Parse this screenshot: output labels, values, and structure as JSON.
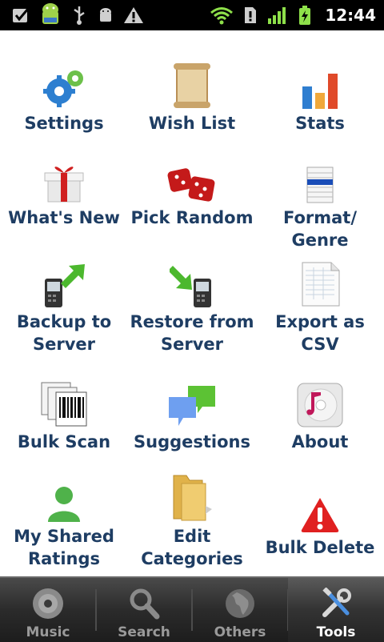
{
  "status": {
    "time": "12:44"
  },
  "tiles": [
    {
      "label": "Settings",
      "icon": "gears-icon"
    },
    {
      "label": "Wish List",
      "icon": "scroll-icon"
    },
    {
      "label": "Stats",
      "icon": "bar-chart-icon"
    },
    {
      "label": "What's New",
      "icon": "gift-icon"
    },
    {
      "label": "Pick Random",
      "icon": "dice-icon"
    },
    {
      "label": "Format/\nGenre",
      "icon": "list-icon"
    },
    {
      "label": "Backup to\nServer",
      "icon": "phone-upload-icon"
    },
    {
      "label": "Restore from\nServer",
      "icon": "phone-download-icon"
    },
    {
      "label": "Export as CSV",
      "icon": "spreadsheet-icon"
    },
    {
      "label": "Bulk Scan",
      "icon": "barcode-icon"
    },
    {
      "label": "Suggestions",
      "icon": "speech-bubbles-icon"
    },
    {
      "label": "About",
      "icon": "music-disc-icon"
    },
    {
      "label": "My Shared\nRatings",
      "icon": "user-icon"
    },
    {
      "label": "Edit\nCategories",
      "icon": "folder-icon"
    },
    {
      "label": "Bulk Delete",
      "icon": "warning-icon"
    }
  ],
  "tabs": [
    {
      "label": "Music",
      "icon": "disc-icon"
    },
    {
      "label": "Search",
      "icon": "magnifier-icon"
    },
    {
      "label": "Others",
      "icon": "globe-icon"
    },
    {
      "label": "Tools",
      "icon": "tools-icon",
      "active": true
    }
  ]
}
